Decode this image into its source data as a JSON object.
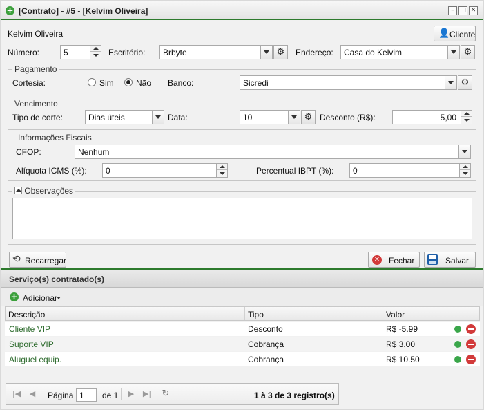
{
  "window": {
    "title": "[Contrato] - #5 - [Kelvim Oliveira]",
    "minimize": "–",
    "restore": "□",
    "close": "✕",
    "accent_color": "#2d7a2d"
  },
  "form": {
    "customer_name": "Kelvim Oliveira",
    "client_button": "Cliente",
    "numero_label": "Número:",
    "numero_value": "5",
    "escritorio_label": "Escritório:",
    "escritorio_value": "Brbyte",
    "endereco_label": "Endereço:",
    "endereco_value": "Casa do Kelvim"
  },
  "pagamento": {
    "legend": "Pagamento",
    "cortesia_label": "Cortesia:",
    "sim_label": "Sim",
    "nao_label": "Não",
    "selected": "Não",
    "banco_label": "Banco:",
    "banco_value": "Sicredi"
  },
  "vencimento": {
    "legend": "Vencimento",
    "tipo_label": "Tipo de corte:",
    "tipo_value": "Dias úteis",
    "data_label": "Data:",
    "data_value": "10",
    "desconto_label": "Desconto (R$):",
    "desconto_value": "5,00"
  },
  "fiscal": {
    "legend": "Informações Fiscais",
    "cfop_label": "CFOP:",
    "cfop_value": "Nenhum",
    "icms_label": "Alíquota ICMS (%):",
    "icms_value": "0",
    "ibpt_label": "Percentual IBPT (%):",
    "ibpt_value": "0"
  },
  "observacoes": {
    "legend": "Observações",
    "value": ""
  },
  "actions": {
    "recarregar": "Recarregar",
    "fechar": "Fechar",
    "salvar": "Salvar"
  },
  "services": {
    "title": "Serviço(s) contratado(s)",
    "add_button": "Adicionar",
    "columns": [
      "Descrição",
      "Tipo",
      "Valor"
    ],
    "rows": [
      {
        "descricao": "Cliente VIP",
        "tipo": "Desconto",
        "valor": "R$ -5.99"
      },
      {
        "descricao": "Suporte VIP",
        "tipo": "Cobrança",
        "valor": "R$ 3.00"
      },
      {
        "descricao": "Aluguel equip.",
        "tipo": "Cobrança",
        "valor": "R$ 10.50"
      }
    ],
    "status_color": "#3aa64a",
    "remove_color": "#d23a3a"
  },
  "pager": {
    "page_label": "Página",
    "page_value": "1",
    "of_label": "de 1",
    "summary": "1 à 3 de 3 registro(s)"
  }
}
